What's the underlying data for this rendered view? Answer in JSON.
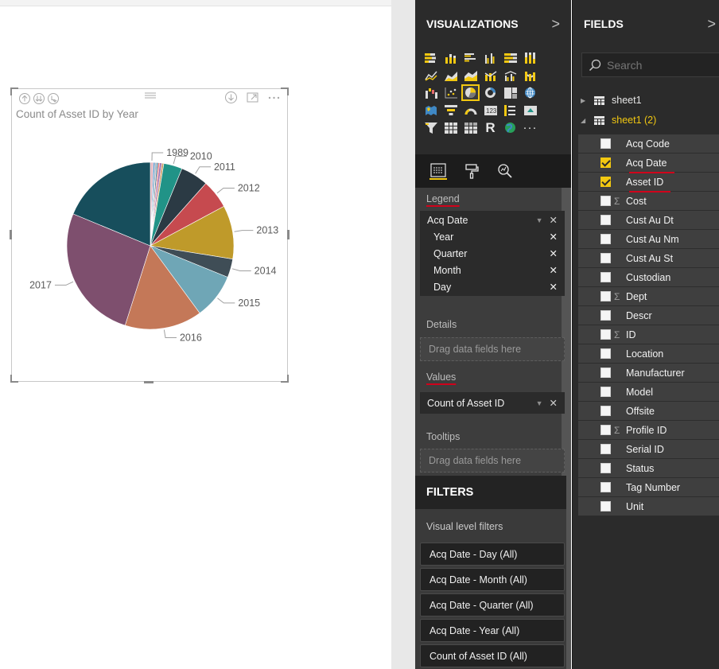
{
  "visual": {
    "title": "Count of Asset ID by Year",
    "chart_data": {
      "type": "pie",
      "slices": [
        {
          "label": "1989",
          "value": 3.0,
          "color": "#e2b6c0",
          "show_label": true
        },
        {
          "label": "",
          "value": 1.5,
          "color": "#3f88c5",
          "show_label": false
        },
        {
          "label": "",
          "value": 1.5,
          "color": "#a8b0b8",
          "show_label": false
        },
        {
          "label": "",
          "value": 1.5,
          "color": "#3f7f9a",
          "show_label": false
        },
        {
          "label": "",
          "value": 1.5,
          "color": "#e46a6f",
          "show_label": false
        },
        {
          "label": "",
          "value": 2.0,
          "color": "#9b6db0",
          "show_label": false
        },
        {
          "label": "",
          "value": 2.0,
          "color": "#cfa06a",
          "show_label": false
        },
        {
          "label": "2010",
          "value": 18.0,
          "color": "#219387",
          "show_label": true
        },
        {
          "label": "2011",
          "value": 27.0,
          "color": "#2b3a44",
          "show_label": true
        },
        {
          "label": "2012",
          "value": 28.0,
          "color": "#c64a4f",
          "show_label": true
        },
        {
          "label": "2013",
          "value": 52.0,
          "color": "#bf9a2a",
          "show_label": true
        },
        {
          "label": "2014",
          "value": 18.0,
          "color": "#3f4d56",
          "show_label": true
        },
        {
          "label": "2015",
          "value": 44.0,
          "color": "#6fa6b6",
          "show_label": true
        },
        {
          "label": "2016",
          "value": 75.0,
          "color": "#c47858",
          "show_label": true
        },
        {
          "label": "2017",
          "value": 132.0,
          "color": "#7e4f6e",
          "show_label": true
        },
        {
          "label": "",
          "value": 94.0,
          "color": "#174e5c",
          "show_label": false
        }
      ]
    }
  },
  "visualizations": {
    "title": "VISUALIZATIONS",
    "expand_glyph": ">",
    "r_visual": "R",
    "more": "···"
  },
  "wells": {
    "legend_label": "Legend",
    "legend_field": "Acq Date",
    "legend_subfields": [
      "Year",
      "Quarter",
      "Month",
      "Day"
    ],
    "details_label": "Details",
    "details_placeholder": "Drag data fields here",
    "values_label": "Values",
    "values_field": "Count of Asset ID",
    "tooltips_label": "Tooltips",
    "tooltips_placeholder": "Drag data fields here",
    "remove_glyph": "✕",
    "dropdown_glyph": "▼"
  },
  "filters": {
    "title": "FILTERS",
    "subtitle": "Visual level filters",
    "items": [
      "Acq Date - Day (All)",
      "Acq Date - Month (All)",
      "Acq Date - Quarter (All)",
      "Acq Date - Year (All)",
      "Count of Asset ID (All)"
    ]
  },
  "fields": {
    "title": "FIELDS",
    "expand_glyph": ">",
    "search_placeholder": "Search",
    "tables": [
      {
        "name": "sheet1",
        "expanded": false
      },
      {
        "name": "sheet1 (2)",
        "expanded": true
      }
    ],
    "list": [
      {
        "name": "Acq Code",
        "checked": false,
        "sigma": false
      },
      {
        "name": "Acq Date",
        "checked": true,
        "sigma": false
      },
      {
        "name": "Asset ID",
        "checked": true,
        "sigma": false
      },
      {
        "name": "Cost",
        "checked": false,
        "sigma": true
      },
      {
        "name": "Cust Au Dt",
        "checked": false,
        "sigma": false
      },
      {
        "name": "Cust Au Nm",
        "checked": false,
        "sigma": false
      },
      {
        "name": "Cust Au St",
        "checked": false,
        "sigma": false
      },
      {
        "name": "Custodian",
        "checked": false,
        "sigma": false
      },
      {
        "name": "Dept",
        "checked": false,
        "sigma": true
      },
      {
        "name": "Descr",
        "checked": false,
        "sigma": false
      },
      {
        "name": "ID",
        "checked": false,
        "sigma": true
      },
      {
        "name": "Location",
        "checked": false,
        "sigma": false
      },
      {
        "name": "Manufacturer",
        "checked": false,
        "sigma": false
      },
      {
        "name": "Model",
        "checked": false,
        "sigma": false
      },
      {
        "name": "Offsite",
        "checked": false,
        "sigma": false
      },
      {
        "name": "Profile ID",
        "checked": false,
        "sigma": true
      },
      {
        "name": "Serial ID",
        "checked": false,
        "sigma": false
      },
      {
        "name": "Status",
        "checked": false,
        "sigma": false
      },
      {
        "name": "Tag Number",
        "checked": false,
        "sigma": false
      },
      {
        "name": "Unit",
        "checked": false,
        "sigma": false
      }
    ]
  },
  "colors": {
    "accent": "#f2c811",
    "annotation_red": "#d0021b",
    "pane_bg": "#2b2b2b"
  }
}
